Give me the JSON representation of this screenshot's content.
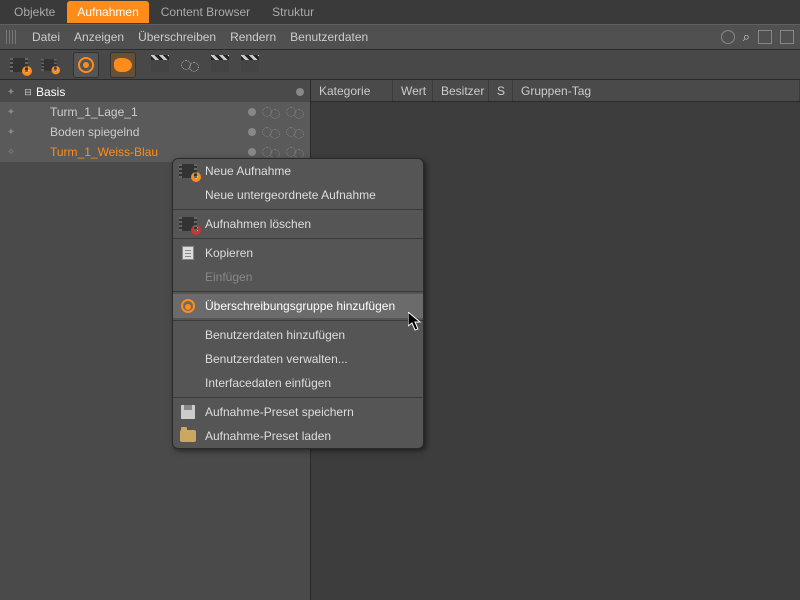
{
  "tabs": [
    "Objekte",
    "Aufnahmen",
    "Content Browser",
    "Struktur"
  ],
  "active_tab": 1,
  "menus": [
    "Datei",
    "Anzeigen",
    "Überschreiben",
    "Rendern",
    "Benutzerdaten"
  ],
  "tree": {
    "root": "Basis",
    "items": [
      "Turm_1_Lage_1",
      "Boden spiegelnd",
      "Turm_1_Weiss-Blau"
    ],
    "selected": 2
  },
  "headers": [
    "Kategorie",
    "Wert",
    "Besitzer",
    "S",
    "Gruppen-Tag"
  ],
  "context_menu": {
    "items": [
      {
        "label": "Neue Aufnahme",
        "icon": "film-plus"
      },
      {
        "label": "Neue untergeordnete Aufnahme"
      },
      {
        "sep": true
      },
      {
        "label": "Aufnahmen löschen",
        "icon": "film-x"
      },
      {
        "sep": true
      },
      {
        "label": "Kopieren",
        "icon": "doc"
      },
      {
        "label": "Einfügen",
        "disabled": true
      },
      {
        "sep": true
      },
      {
        "label": "Überschreibungsgruppe hinzufügen",
        "icon": "ring",
        "hover": true
      },
      {
        "sep": true
      },
      {
        "label": "Benutzerdaten hinzufügen"
      },
      {
        "label": "Benutzerdaten verwalten..."
      },
      {
        "label": "Interfacedaten einfügen"
      },
      {
        "sep": true
      },
      {
        "label": "Aufnahme-Preset speichern",
        "icon": "disk"
      },
      {
        "label": "Aufnahme-Preset laden",
        "icon": "folder"
      }
    ]
  }
}
